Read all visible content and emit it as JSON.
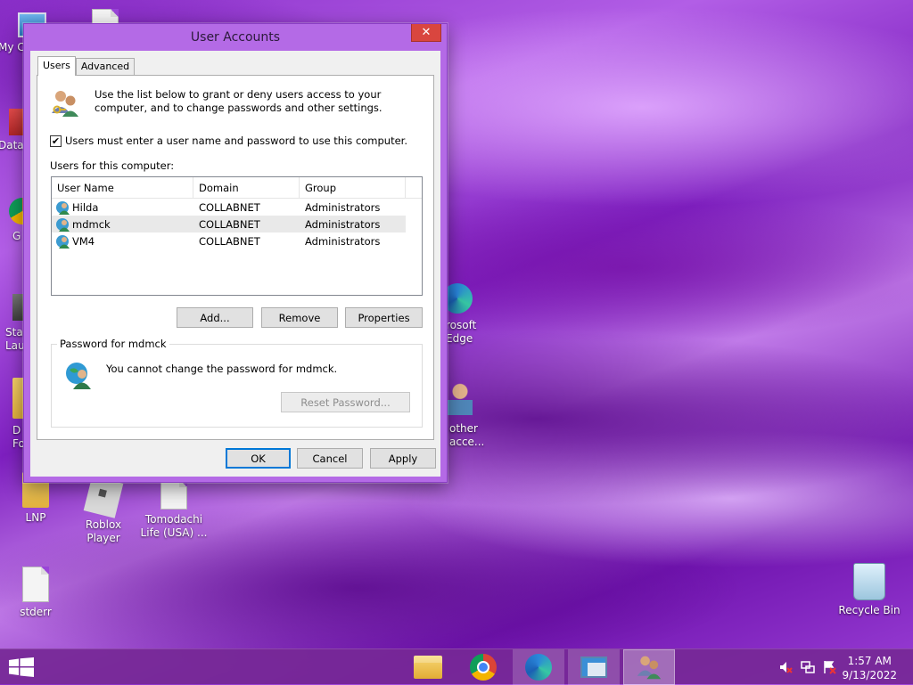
{
  "desktop": {
    "icons": [
      {
        "label": "My C"
      },
      {
        "label": "Data"
      },
      {
        "label": "G C"
      },
      {
        "label": "Star Laun"
      },
      {
        "label": "D Fo"
      },
      {
        "label": "LNP"
      },
      {
        "label": "Roblox Player"
      },
      {
        "label": "Tomodachi Life (USA) ..."
      },
      {
        "label": "stderr"
      },
      {
        "label": "rosoft Edge"
      },
      {
        "label": "other acce..."
      },
      {
        "label": "Recycle Bin"
      }
    ]
  },
  "window": {
    "title": "User Accounts",
    "close_glyph": "✕",
    "tabs": [
      {
        "label": "Users"
      },
      {
        "label": "Advanced"
      }
    ],
    "intro_text": "Use the list below to grant or deny users access to your computer, and to change passwords and other settings.",
    "require_login_checkbox": {
      "label": "Users must enter a user name and password to use this computer.",
      "checked_glyph": "✔"
    },
    "users_label": "Users for this computer:",
    "table": {
      "columns": [
        "User Name",
        "Domain",
        "Group"
      ],
      "rows": [
        {
          "user": "Hilda",
          "domain": "COLLABNET",
          "group": "Administrators"
        },
        {
          "user": "mdmck",
          "domain": "COLLABNET",
          "group": "Administrators"
        },
        {
          "user": "VM4",
          "domain": "COLLABNET",
          "group": "Administrators"
        }
      ]
    },
    "buttons": {
      "add": "Add...",
      "remove": "Remove",
      "properties": "Properties",
      "reset_password": "Reset Password...",
      "ok": "OK",
      "cancel": "Cancel",
      "apply": "Apply"
    },
    "password_group": {
      "title": "Password for mdmck",
      "text": "You cannot change the password for mdmck."
    }
  },
  "taskbar": {
    "time": "1:57 AM",
    "date": "9/13/2022"
  },
  "colors": {
    "accent": "#0078d7",
    "window_frame": "#b46ae6",
    "close_button": "#d9463f",
    "taskbar": "#762896"
  }
}
